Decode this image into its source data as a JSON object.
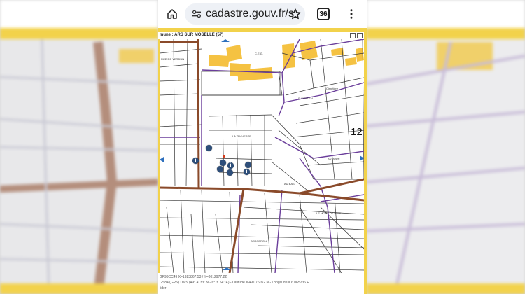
{
  "browser": {
    "url": "cadastre.gouv.fr/s",
    "tab_count": "36"
  },
  "map": {
    "title": "mune : ARS SUR MOSELLE (57)",
    "big_label": "12",
    "labels": [
      "C.E.G.",
      "RUE DE VERDUN",
      "Cimetière",
      "LE CHATEAU",
      "AU JOUR",
      "AU BAS",
      "LA TRAVERSE",
      "LE MONT DE BOIS",
      "BERGERON"
    ]
  },
  "footer": {
    "line1": "GF93CC49        X=1923867.53 / Y=8012977.22",
    "line2": "GS84 (GPS)    DMS (49° 4' 33\" N - 6° 3' 54\" E) - Latitude = 49.076052 N - Longitude = 6.065236 E",
    "line3": "lider"
  },
  "colors": {
    "frame": "#f2d24b",
    "building": "#f5c242",
    "road": "#8a4a2a",
    "boundary": "#6a3d9a",
    "marker": "#2d4e7a"
  }
}
